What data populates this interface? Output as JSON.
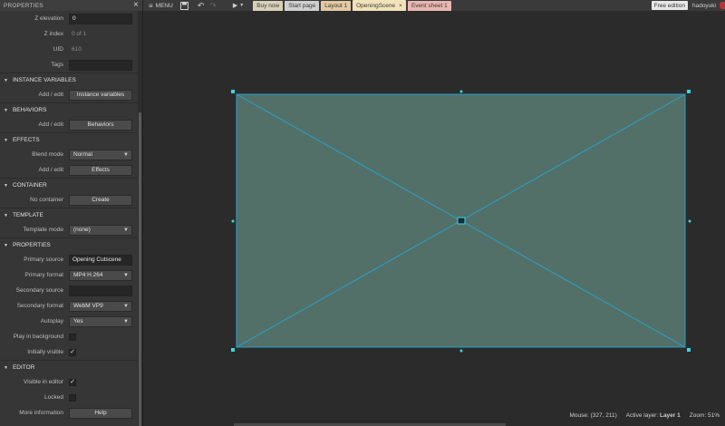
{
  "panel": {
    "title": "PROPERTIES",
    "rows_top": [
      {
        "label": "Z elevation",
        "kind": "input",
        "value": "0"
      },
      {
        "label": "Z index",
        "kind": "static",
        "value": "0 of 1"
      },
      {
        "label": "UID",
        "kind": "static",
        "value": "610"
      },
      {
        "label": "Tags",
        "kind": "input",
        "value": ""
      }
    ],
    "sections": {
      "instance_variables": "INSTANCE VARIABLES",
      "behaviors": "BEHAVIORS",
      "effects": "EFFECTS",
      "container": "CONTAINER",
      "template": "TEMPLATE",
      "properties": "PROPERTIES",
      "editor": "EDITOR"
    },
    "instance_variables": {
      "label": "Add / edit",
      "button": "Instance variables"
    },
    "behaviors": {
      "label": "Add / edit",
      "button": "Behaviors"
    },
    "effects": {
      "blend_label": "Blend mode",
      "blend_value": "Normal",
      "label": "Add / edit",
      "button": "Effects"
    },
    "container": {
      "label": "No container",
      "button": "Create"
    },
    "template": {
      "label": "Template mode",
      "value": "(none)"
    },
    "properties": {
      "primary_source_label": "Primary source",
      "primary_source_value": "Opening Cutscene",
      "primary_format_label": "Primary format",
      "primary_format_value": "MP4 H.264",
      "secondary_source_label": "Secondary source",
      "secondary_source_value": "",
      "secondary_format_label": "Secondary format",
      "secondary_format_value": "WebM VP9",
      "autoplay_label": "Autoplay",
      "autoplay_value": "Yes",
      "play_bg_label": "Play in background",
      "play_bg_checked": false,
      "initially_visible_label": "Initially visible",
      "initially_visible_checked": true
    },
    "editor": {
      "visible_label": "Visible in editor",
      "visible_checked": true,
      "locked_label": "Locked",
      "locked_checked": false,
      "more_info_label": "More information",
      "help_button": "Help"
    }
  },
  "toolbar": {
    "menu_label": "MENU",
    "tabs": [
      {
        "label": "Buy now",
        "color": "#d8d0b8"
      },
      {
        "label": "Start page",
        "color": "#cfcfcf"
      },
      {
        "label": "Layout 1",
        "color": "#e2c9a0"
      },
      {
        "label": "OpeningScene",
        "color": "#f1e2b9"
      },
      {
        "label": "Event sheet 1",
        "color": "#e8b7b0"
      }
    ],
    "close_glyph": "×",
    "free_edition": "Free edition",
    "username": "hadoyuki"
  },
  "status": {
    "mouse": "Mouse: (327, 211)",
    "active_layer_label": "Active layer:",
    "active_layer_value": "Layer 1",
    "zoom": "Zoom: 51%"
  },
  "colors": {
    "object_fill": "#527068",
    "object_stroke": "#27a0c8",
    "handle": "#3ad6e6"
  }
}
